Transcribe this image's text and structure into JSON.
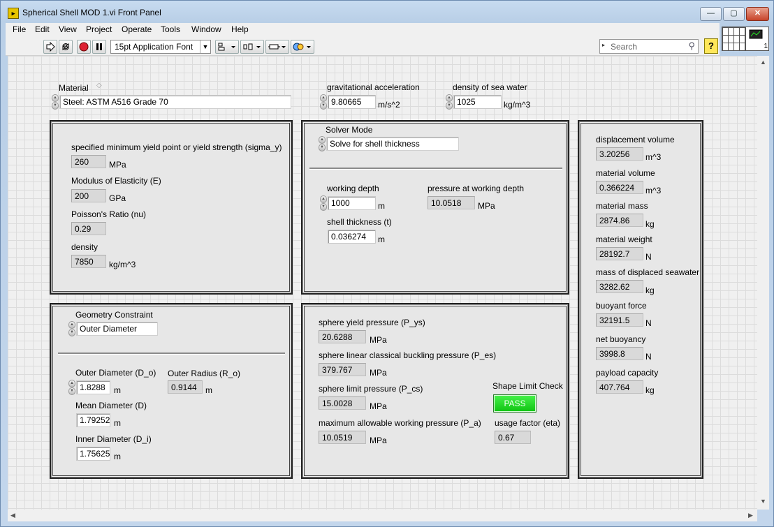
{
  "window": {
    "title": "Spherical Shell MOD 1.vi Front Panel",
    "icon": "labview-vi-icon",
    "min": "—",
    "max": "▢",
    "close": "✕"
  },
  "menu": [
    "File",
    "Edit",
    "View",
    "Project",
    "Operate",
    "Tools",
    "Window",
    "Help"
  ],
  "toolbar": {
    "font": "15pt Application Font",
    "search_placeholder": "Search",
    "help": "?",
    "vi_number": "1"
  },
  "material": {
    "label": "Material",
    "value": "Steel: ASTM A516 Grade 70"
  },
  "gravity": {
    "label": "gravitational acceleration",
    "value": "9.80665",
    "unit": "m/s^2"
  },
  "seawater": {
    "label": "density of sea water",
    "value": "1025",
    "unit": "kg/m^3"
  },
  "props": {
    "yield": {
      "label": "specified minimum yield point or yield strength (sigma_y)",
      "value": "260",
      "unit": "MPa"
    },
    "modulus": {
      "label": "Modulus of Elasticity (E)",
      "value": "200",
      "unit": "GPa"
    },
    "poisson": {
      "label": "Poisson's Ratio (nu)",
      "value": "0.29"
    },
    "density": {
      "label": "density",
      "value": "7850",
      "unit": "kg/m^3"
    }
  },
  "solver": {
    "label": "Solver Mode",
    "value": "Solve for shell thickness",
    "depth": {
      "label": "working depth",
      "value": "1000",
      "unit": "m"
    },
    "pressure": {
      "label": "pressure at working depth",
      "value": "10.0518",
      "unit": "MPa"
    },
    "thickness": {
      "label": "shell thickness (t)",
      "value": "0.036274",
      "unit": "m"
    }
  },
  "geometry": {
    "label": "Geometry Constraint",
    "value": "Outer Diameter",
    "outer_d": {
      "label": "Outer Diameter (D_o)",
      "value": "1.8288",
      "unit": "m"
    },
    "outer_r": {
      "label": "Outer Radius (R_o)",
      "value": "0.9144",
      "unit": "m"
    },
    "mean_d": {
      "label": "Mean Diameter (D)",
      "value": "1.79252",
      "unit": "m"
    },
    "inner_d": {
      "label": "Inner Diameter (D_i)",
      "value": "1.75625",
      "unit": "m"
    }
  },
  "pressures": {
    "yield": {
      "label": "sphere yield pressure (P_ys)",
      "value": "20.6288",
      "unit": "MPa"
    },
    "buckling": {
      "label": "sphere linear classical buckling pressure (P_es)",
      "value": "379.767",
      "unit": "MPa"
    },
    "limit": {
      "label": "sphere limit pressure (P_cs)",
      "value": "15.0028",
      "unit": "MPa"
    },
    "allowable": {
      "label": "maximum allowable working pressure (P_a)",
      "value": "10.0519",
      "unit": "MPa"
    },
    "shape_check": {
      "label": "Shape Limit Check",
      "value": "PASS",
      "color": "#22dd22"
    },
    "usage": {
      "label": "usage factor (eta)",
      "value": "0.67"
    }
  },
  "results": {
    "disp_vol": {
      "label": "displacement volume",
      "value": "3.20256",
      "unit": "m^3"
    },
    "mat_vol": {
      "label": "material volume",
      "value": "0.366224",
      "unit": "m^3"
    },
    "mat_mass": {
      "label": "material mass",
      "value": "2874.86",
      "unit": "kg"
    },
    "mat_weight": {
      "label": "material weight",
      "value": "28192.7",
      "unit": "N"
    },
    "disp_mass": {
      "label": "mass of displaced seawater",
      "value": "3282.62",
      "unit": "kg"
    },
    "buoyant": {
      "label": "buoyant force",
      "value": "32191.5",
      "unit": "N"
    },
    "net": {
      "label": "net buoyancy",
      "value": "3998.8",
      "unit": "N"
    },
    "payload": {
      "label": "payload capacity",
      "value": "407.764",
      "unit": "kg"
    }
  }
}
